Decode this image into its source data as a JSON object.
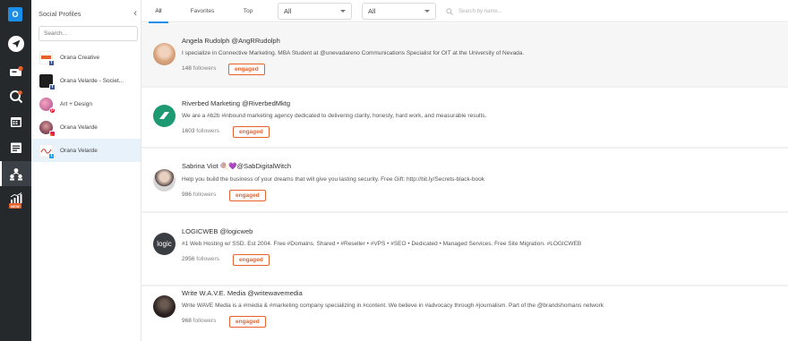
{
  "rail": {
    "logo_letter": "O",
    "items": [
      {
        "icon": "compose-icon"
      },
      {
        "icon": "inbox-icon"
      },
      {
        "icon": "search-analytics-icon"
      },
      {
        "icon": "calendar-icon"
      },
      {
        "icon": "planner-icon"
      },
      {
        "icon": "audience-icon"
      },
      {
        "icon": "reports-icon"
      }
    ],
    "new_badge": "NEW"
  },
  "profiles": {
    "title": "Social Profiles",
    "search_placeholder": "Search...",
    "items": [
      {
        "name": "Orana Creative",
        "network": "facebook"
      },
      {
        "name": "Orana Velarde - Societ...",
        "network": "facebook"
      },
      {
        "name": "Art + Design",
        "network": "pinterest"
      },
      {
        "name": "Orana Velarde",
        "network": "instagram"
      },
      {
        "name": "Orana Velarde",
        "network": "twitter",
        "selected": true
      }
    ]
  },
  "topbar": {
    "tabs": [
      "All",
      "Favorites",
      "Top"
    ],
    "active_tab": "All",
    "filter1": "All",
    "filter2": "All",
    "search_placeholder": "Search by name..."
  },
  "feed": {
    "engaged_label": "engaged",
    "followers_label": "followers",
    "cards": [
      {
        "name": "Angela Rudolph @AngRRudolph",
        "bio": "I specialize in Connective Marketing. MBA Student at @unevadareno Communications Specialist for OIT at the University of Nevada.",
        "followers": "148"
      },
      {
        "name": "Riverbed Marketing @RiverbedMktg",
        "bio": "We are a #b2b #inbound marketing agency dedicated to delivering clarity, honesty, hard work, and measurable results.",
        "followers": "1603"
      },
      {
        "name": "Sabrina Viot 🍭💜@SabDigitalWitch",
        "bio": "Help you build the business of your dreams that will give you lasting security. Free Gift: http://bit.ly/Secrets-black-book",
        "followers": "986"
      },
      {
        "name": "LOGICWEB @logicweb",
        "bio": "#1 Web Hosting w/ SSD. Est 2004. Free #Domains. Shared • #Reseller • #VPS • #SEO • Dedicated • Managed Services. Free Site Migration. #LOGICWEB",
        "followers": "2956",
        "avatar_text": "logic"
      },
      {
        "name": "Write W.A.V.E. Media @writewavemedia",
        "bio": "Write WAVE Media is a #media & #marketing company specializing in #content. We believe in #advocacy through #journalism. Part of the @brandshomans network",
        "followers": "968"
      }
    ]
  },
  "colors": {
    "rail_bg": "#25292c",
    "accent_blue": "#1b8ee8",
    "engaged_orange": "#e8612c",
    "selected_bg": "#e7f2fb"
  }
}
